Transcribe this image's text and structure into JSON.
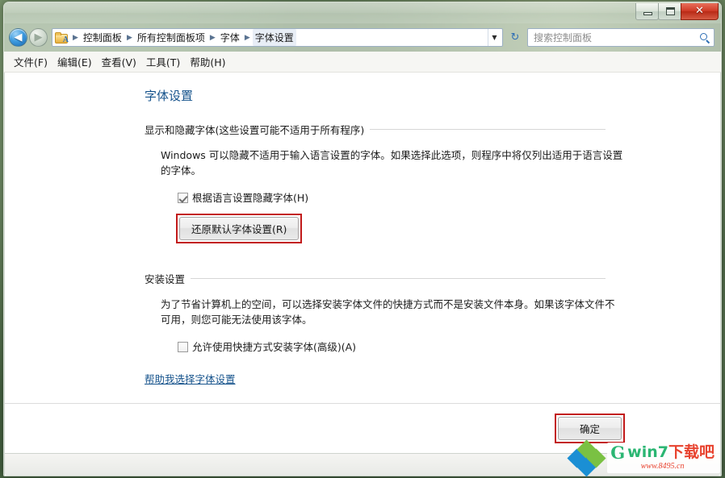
{
  "window": {
    "controls": {
      "minimize": "−",
      "maximize": "❐",
      "close": "✕"
    }
  },
  "navbar": {
    "back_arrow": "◀",
    "forward_arrow": "▶",
    "folder_letter": "A",
    "breadcrumbs": [
      "控制面板",
      "所有控制面板项",
      "字体",
      "字体设置"
    ],
    "separator": "▶",
    "dropdown_arrow": "▼",
    "refresh_icon": "↻",
    "search": {
      "placeholder": "搜索控制面板",
      "value": ""
    }
  },
  "menubar": {
    "items": [
      "文件(F)",
      "编辑(E)",
      "查看(V)",
      "工具(T)",
      "帮助(H)"
    ]
  },
  "main": {
    "page_title": "字体设置",
    "section1": {
      "header": "显示和隐藏字体(这些设置可能不适用于所有程序)",
      "description": "Windows 可以隐藏不适用于输入语言设置的字体。如果选择此选项，则程序中将仅列出适用于语言设置的字体。",
      "checkbox_label": "根据语言设置隐藏字体(H)",
      "checkbox_checked": true,
      "restore_button": "还原默认字体设置(R)"
    },
    "section2": {
      "header": "安装设置",
      "description": "为了节省计算机上的空间，可以选择安装字体文件的快捷方式而不是安装文件本身。如果该字体文件不可用，则您可能无法使用该字体。",
      "checkbox_label": "允许使用快捷方式安装字体(高级)(A)",
      "checkbox_checked": false
    },
    "help_link": "帮助我选择字体设置"
  },
  "footer": {
    "ok_button": "确定"
  },
  "watermark": {
    "logo_letter": "G",
    "title_main": "win7",
    "title_cn": "下载吧",
    "url": "www.8495.cn"
  },
  "colors": {
    "annotation_red": "#c21a1a",
    "link_blue": "#16538c",
    "title_blue": "#16538c"
  }
}
